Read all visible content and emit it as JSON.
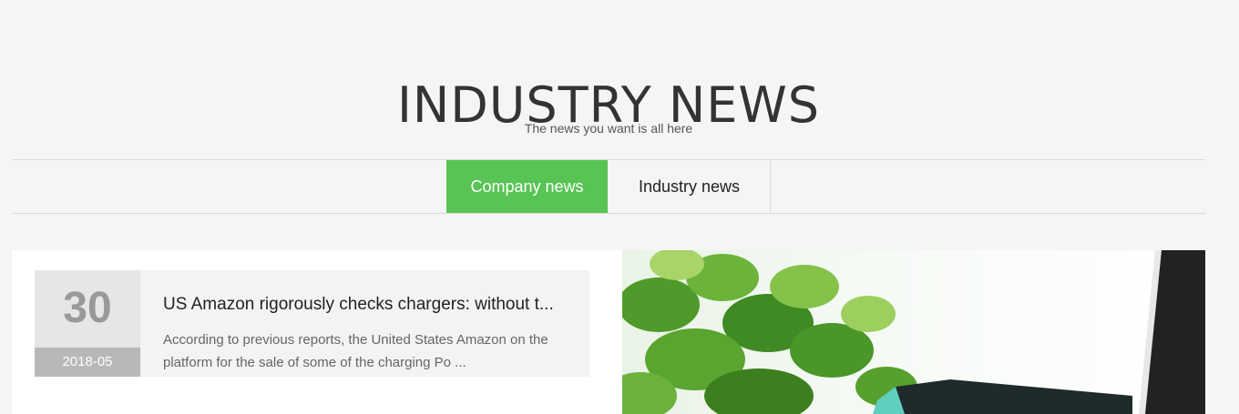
{
  "header": {
    "title": "INDUSTRY NEWS",
    "subtitle": "The news you want is all here"
  },
  "tabs": [
    {
      "label": "Company news",
      "active": true
    },
    {
      "label": "Industry news",
      "active": false
    }
  ],
  "news": {
    "day": "30",
    "year_month": "2018-05",
    "title": "US Amazon rigorously checks chargers: without t...",
    "excerpt": "According to previous reports, the United States Amazon on the platform for the sale of some of the charging Po ..."
  },
  "colors": {
    "accent": "#57c454",
    "background": "#f5f5f5"
  }
}
